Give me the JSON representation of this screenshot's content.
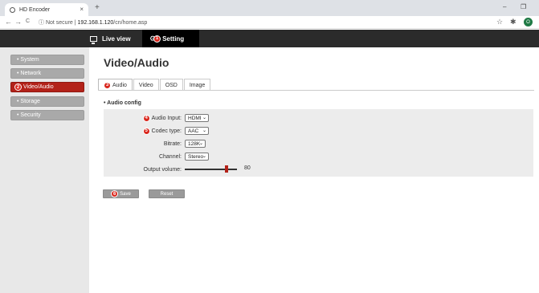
{
  "browser": {
    "tab_title": "HD Encoder",
    "new_tab": "+",
    "tab_close": "×",
    "nav_back": "←",
    "nav_forward": "→",
    "nav_reload": "C",
    "security": "ⓘ Not secure",
    "separator": "|",
    "url_host": "192.168.1.120",
    "url_path": "/cn/home.asp",
    "minimize": "–",
    "restore": "❐",
    "star": "☆",
    "extensions": "✱",
    "profile_initial": "O"
  },
  "header": {
    "live_view": "Live view",
    "setting": "Setting",
    "setting_badge": "1"
  },
  "sidebar": {
    "items": [
      {
        "label": "• System"
      },
      {
        "label": "• Network"
      },
      {
        "label": "Video/Audio",
        "badge": "2"
      },
      {
        "label": "• Storage"
      },
      {
        "label": "• Security"
      }
    ]
  },
  "main": {
    "title": "Video/Audio",
    "tabs": [
      {
        "label": "Audio",
        "badge": "3"
      },
      {
        "label": "Video"
      },
      {
        "label": "OSD"
      },
      {
        "label": "Image"
      }
    ],
    "section": "• Audio config",
    "fields": {
      "audio_input": {
        "label": "Audio Input:",
        "value": "HDMI",
        "badge": "4"
      },
      "codec_type": {
        "label": "Codec type:",
        "value": "AAC",
        "badge": "5"
      },
      "bitrate": {
        "label": "Bitrate:",
        "value": "128K"
      },
      "channel": {
        "label": "Channel:",
        "value": "Stereo"
      },
      "output_volume": {
        "label": "Output volume:",
        "value": "80",
        "level": 0.8
      }
    },
    "buttons": {
      "save": "Save",
      "save_badge": "6",
      "reset": "Reset"
    }
  },
  "colors": {
    "accent": "#b32219",
    "badge": "#d9261c",
    "header": "#2b2b2b"
  }
}
